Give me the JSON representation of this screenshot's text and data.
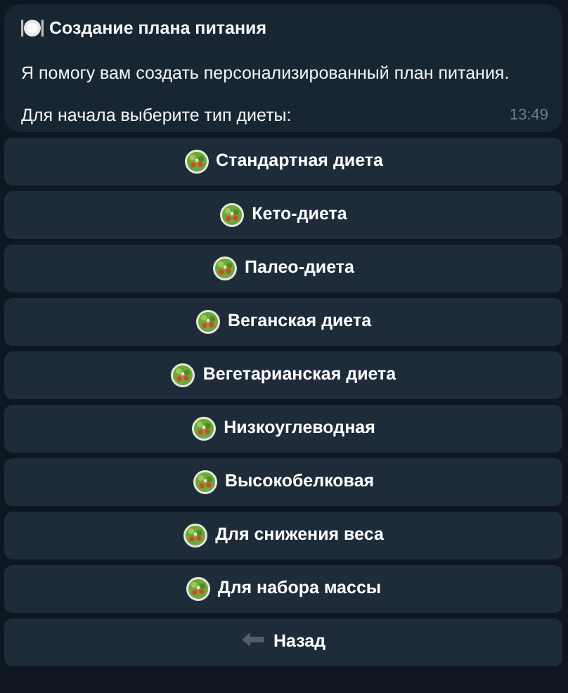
{
  "message": {
    "title": "Создание плана питания",
    "lines": [
      "Я помогу вам создать персонализированный план питания.",
      "Для начала выберите тип диеты:"
    ],
    "time": "13:49"
  },
  "buttons": [
    {
      "kind": "salad",
      "label": "Стандартная диета"
    },
    {
      "kind": "salad",
      "label": "Кето-диета"
    },
    {
      "kind": "salad",
      "label": "Палео-диета"
    },
    {
      "kind": "salad",
      "label": "Веганская диета"
    },
    {
      "kind": "salad",
      "label": "Вегетарианская диета"
    },
    {
      "kind": "salad",
      "label": "Низкоуглеводная"
    },
    {
      "kind": "salad",
      "label": "Высокобелковая"
    },
    {
      "kind": "salad",
      "label": "Для снижения веса"
    },
    {
      "kind": "salad",
      "label": "Для набора массы"
    },
    {
      "kind": "back",
      "label": "Назад"
    }
  ]
}
